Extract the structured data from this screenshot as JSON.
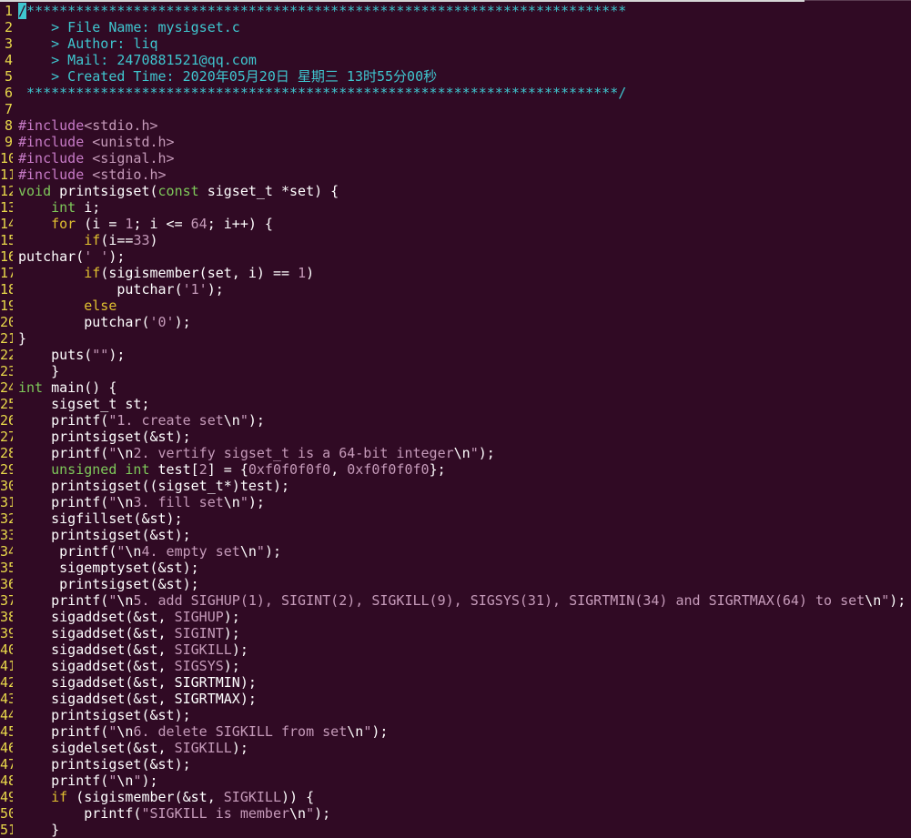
{
  "colors": {
    "background": "#300a24",
    "line_number": "#e8d84a",
    "comment": "#3fc6cf",
    "preprocessor": "#c77bc7",
    "type": "#7ec85a",
    "keyword": "#e0c030",
    "string": "#c59ab9",
    "text": "#ffffff"
  },
  "lines": [
    {
      "n": "1",
      "tokens": [
        {
          "t": "/",
          "c": "cursor"
        },
        {
          "t": "*************************************************************************",
          "c": "comment"
        }
      ]
    },
    {
      "n": "2",
      "tokens": [
        {
          "t": "    > File Name: mysigset.c",
          "c": "comment"
        }
      ]
    },
    {
      "n": "3",
      "tokens": [
        {
          "t": "    > Author: liq",
          "c": "comment"
        }
      ]
    },
    {
      "n": "4",
      "tokens": [
        {
          "t": "    > Mail: 2470881521@qq.com",
          "c": "comment"
        }
      ]
    },
    {
      "n": "5",
      "tokens": [
        {
          "t": "    > Created Time: 2020年05月20日 星期三 13时55分00秒",
          "c": "comment"
        }
      ]
    },
    {
      "n": "6",
      "tokens": [
        {
          "t": " ************************************************************************/",
          "c": "comment"
        }
      ]
    },
    {
      "n": "7",
      "tokens": []
    },
    {
      "n": "8",
      "tokens": [
        {
          "t": "#include",
          "c": "pp"
        },
        {
          "t": "<stdio.h>",
          "c": "str"
        }
      ]
    },
    {
      "n": "9",
      "tokens": [
        {
          "t": "#include ",
          "c": "pp"
        },
        {
          "t": "<unistd.h>",
          "c": "str"
        }
      ]
    },
    {
      "n": "10",
      "tokens": [
        {
          "t": "#include ",
          "c": "pp"
        },
        {
          "t": "<signal.h>",
          "c": "str"
        }
      ]
    },
    {
      "n": "11",
      "tokens": [
        {
          "t": "#include ",
          "c": "pp"
        },
        {
          "t": "<stdio.h>",
          "c": "str"
        }
      ]
    },
    {
      "n": "12",
      "tokens": [
        {
          "t": "void",
          "c": "type"
        },
        {
          "t": " printsigset(",
          "c": "plain"
        },
        {
          "t": "const",
          "c": "type"
        },
        {
          "t": " sigset_t *set) {",
          "c": "plain"
        }
      ]
    },
    {
      "n": "13",
      "tokens": [
        {
          "t": "    ",
          "c": "plain"
        },
        {
          "t": "int",
          "c": "type"
        },
        {
          "t": " i;",
          "c": "plain"
        }
      ]
    },
    {
      "n": "14",
      "tokens": [
        {
          "t": "    ",
          "c": "plain"
        },
        {
          "t": "for",
          "c": "kw"
        },
        {
          "t": " (i = ",
          "c": "plain"
        },
        {
          "t": "1",
          "c": "num"
        },
        {
          "t": "; i <= ",
          "c": "plain"
        },
        {
          "t": "64",
          "c": "num"
        },
        {
          "t": "; i++) {",
          "c": "plain"
        }
      ]
    },
    {
      "n": "15",
      "tokens": [
        {
          "t": "        ",
          "c": "plain"
        },
        {
          "t": "if",
          "c": "kw"
        },
        {
          "t": "(i==",
          "c": "plain"
        },
        {
          "t": "33",
          "c": "num"
        },
        {
          "t": ")",
          "c": "plain"
        }
      ]
    },
    {
      "n": "16",
      "tokens": [
        {
          "t": "putchar(",
          "c": "plain"
        },
        {
          "t": "' '",
          "c": "str"
        },
        {
          "t": ");",
          "c": "plain"
        }
      ]
    },
    {
      "n": "17",
      "tokens": [
        {
          "t": "        ",
          "c": "plain"
        },
        {
          "t": "if",
          "c": "kw"
        },
        {
          "t": "(sigismember(set, i) == ",
          "c": "plain"
        },
        {
          "t": "1",
          "c": "num"
        },
        {
          "t": ")",
          "c": "plain"
        }
      ]
    },
    {
      "n": "18",
      "tokens": [
        {
          "t": "            putchar(",
          "c": "plain"
        },
        {
          "t": "'1'",
          "c": "str"
        },
        {
          "t": ");",
          "c": "plain"
        }
      ]
    },
    {
      "n": "19",
      "tokens": [
        {
          "t": "        ",
          "c": "plain"
        },
        {
          "t": "else",
          "c": "kw"
        }
      ]
    },
    {
      "n": "20",
      "tokens": [
        {
          "t": "        putchar(",
          "c": "plain"
        },
        {
          "t": "'0'",
          "c": "str"
        },
        {
          "t": ");",
          "c": "plain"
        }
      ]
    },
    {
      "n": "21",
      "tokens": [
        {
          "t": "}",
          "c": "plain"
        }
      ]
    },
    {
      "n": "22",
      "tokens": [
        {
          "t": "    puts(",
          "c": "plain"
        },
        {
          "t": "\"\"",
          "c": "str"
        },
        {
          "t": ");",
          "c": "plain"
        }
      ]
    },
    {
      "n": "23",
      "tokens": [
        {
          "t": "    }",
          "c": "plain"
        }
      ]
    },
    {
      "n": "24",
      "tokens": [
        {
          "t": "int",
          "c": "type"
        },
        {
          "t": " main() {",
          "c": "plain"
        }
      ]
    },
    {
      "n": "25",
      "tokens": [
        {
          "t": "    sigset_t st;",
          "c": "plain"
        }
      ]
    },
    {
      "n": "26",
      "tokens": [
        {
          "t": "    printf(",
          "c": "plain"
        },
        {
          "t": "\"1. create set",
          "c": "str"
        },
        {
          "t": "\\n",
          "c": "plain"
        },
        {
          "t": "\"",
          "c": "str"
        },
        {
          "t": ");",
          "c": "plain"
        }
      ]
    },
    {
      "n": "27",
      "tokens": [
        {
          "t": "    printsigset(&st);",
          "c": "plain"
        }
      ]
    },
    {
      "n": "28",
      "tokens": [
        {
          "t": "    printf(",
          "c": "plain"
        },
        {
          "t": "\"",
          "c": "str"
        },
        {
          "t": "\\n",
          "c": "plain"
        },
        {
          "t": "2. vertify sigset_t is a 64-bit integer",
          "c": "str"
        },
        {
          "t": "\\n",
          "c": "plain"
        },
        {
          "t": "\"",
          "c": "str"
        },
        {
          "t": ");",
          "c": "plain"
        }
      ]
    },
    {
      "n": "29",
      "tokens": [
        {
          "t": "    ",
          "c": "plain"
        },
        {
          "t": "unsigned",
          "c": "type"
        },
        {
          "t": " ",
          "c": "plain"
        },
        {
          "t": "int",
          "c": "type"
        },
        {
          "t": " test[",
          "c": "plain"
        },
        {
          "t": "2",
          "c": "num"
        },
        {
          "t": "] = {",
          "c": "plain"
        },
        {
          "t": "0xf0f0f0f0",
          "c": "num"
        },
        {
          "t": ", ",
          "c": "plain"
        },
        {
          "t": "0xf0f0f0f0",
          "c": "num"
        },
        {
          "t": "};",
          "c": "plain"
        }
      ]
    },
    {
      "n": "30",
      "tokens": [
        {
          "t": "    printsigset((sigset_t*)test);",
          "c": "plain"
        }
      ]
    },
    {
      "n": "31",
      "tokens": [
        {
          "t": "    printf(",
          "c": "plain"
        },
        {
          "t": "\"",
          "c": "str"
        },
        {
          "t": "\\n",
          "c": "plain"
        },
        {
          "t": "3. fill set",
          "c": "str"
        },
        {
          "t": "\\n",
          "c": "plain"
        },
        {
          "t": "\"",
          "c": "str"
        },
        {
          "t": ");",
          "c": "plain"
        }
      ]
    },
    {
      "n": "32",
      "tokens": [
        {
          "t": "    sigfillset(&st);",
          "c": "plain"
        }
      ]
    },
    {
      "n": "33",
      "tokens": [
        {
          "t": "    printsigset(&st);",
          "c": "plain"
        }
      ]
    },
    {
      "n": "34",
      "tokens": [
        {
          "t": "     printf(",
          "c": "plain"
        },
        {
          "t": "\"",
          "c": "str"
        },
        {
          "t": "\\n",
          "c": "plain"
        },
        {
          "t": "4. empty set",
          "c": "str"
        },
        {
          "t": "\\n",
          "c": "plain"
        },
        {
          "t": "\"",
          "c": "str"
        },
        {
          "t": ");",
          "c": "plain"
        }
      ]
    },
    {
      "n": "35",
      "tokens": [
        {
          "t": "     sigemptyset(&st);",
          "c": "plain"
        }
      ]
    },
    {
      "n": "36",
      "tokens": [
        {
          "t": "     printsigset(&st);",
          "c": "plain"
        }
      ]
    },
    {
      "n": "37",
      "tokens": [
        {
          "t": "    printf(",
          "c": "plain"
        },
        {
          "t": "\"",
          "c": "str"
        },
        {
          "t": "\\n",
          "c": "plain"
        },
        {
          "t": "5. add SIGHUP(1), SIGINT(2), SIGKILL(9), SIGSYS(31), SIGRTMIN(34) and SIGRTMAX(64) to set",
          "c": "str"
        },
        {
          "t": "\\n",
          "c": "plain"
        },
        {
          "t": "\"",
          "c": "str"
        },
        {
          "t": ");",
          "c": "plain"
        }
      ]
    },
    {
      "n": "38",
      "tokens": [
        {
          "t": "    sigaddset(&st, ",
          "c": "plain"
        },
        {
          "t": "SIGHUP",
          "c": "const"
        },
        {
          "t": ");",
          "c": "plain"
        }
      ]
    },
    {
      "n": "39",
      "tokens": [
        {
          "t": "    sigaddset(&st, ",
          "c": "plain"
        },
        {
          "t": "SIGINT",
          "c": "const"
        },
        {
          "t": ");",
          "c": "plain"
        }
      ]
    },
    {
      "n": "40",
      "tokens": [
        {
          "t": "    sigaddset(&st, ",
          "c": "plain"
        },
        {
          "t": "SIGKILL",
          "c": "const"
        },
        {
          "t": ");",
          "c": "plain"
        }
      ]
    },
    {
      "n": "41",
      "tokens": [
        {
          "t": "    sigaddset(&st, ",
          "c": "plain"
        },
        {
          "t": "SIGSYS",
          "c": "const"
        },
        {
          "t": ");",
          "c": "plain"
        }
      ]
    },
    {
      "n": "42",
      "tokens": [
        {
          "t": "    sigaddset(&st, SIGRTMIN);",
          "c": "plain"
        }
      ]
    },
    {
      "n": "43",
      "tokens": [
        {
          "t": "    sigaddset(&st, SIGRTMAX);",
          "c": "plain"
        }
      ]
    },
    {
      "n": "44",
      "tokens": [
        {
          "t": "    printsigset(&st);",
          "c": "plain"
        }
      ]
    },
    {
      "n": "45",
      "tokens": [
        {
          "t": "    printf(",
          "c": "plain"
        },
        {
          "t": "\"",
          "c": "str"
        },
        {
          "t": "\\n",
          "c": "plain"
        },
        {
          "t": "6. delete SIGKILL from set",
          "c": "str"
        },
        {
          "t": "\\n",
          "c": "plain"
        },
        {
          "t": "\"",
          "c": "str"
        },
        {
          "t": ");",
          "c": "plain"
        }
      ]
    },
    {
      "n": "46",
      "tokens": [
        {
          "t": "    sigdelset(&st, ",
          "c": "plain"
        },
        {
          "t": "SIGKILL",
          "c": "const"
        },
        {
          "t": ");",
          "c": "plain"
        }
      ]
    },
    {
      "n": "47",
      "tokens": [
        {
          "t": "    printsigset(&st);",
          "c": "plain"
        }
      ]
    },
    {
      "n": "48",
      "tokens": [
        {
          "t": "    printf(",
          "c": "plain"
        },
        {
          "t": "\"",
          "c": "str"
        },
        {
          "t": "\\n",
          "c": "plain"
        },
        {
          "t": "\"",
          "c": "str"
        },
        {
          "t": ");",
          "c": "plain"
        }
      ]
    },
    {
      "n": "49",
      "tokens": [
        {
          "t": "    ",
          "c": "plain"
        },
        {
          "t": "if",
          "c": "kw"
        },
        {
          "t": " (sigismember(&st, ",
          "c": "plain"
        },
        {
          "t": "SIGKILL",
          "c": "const"
        },
        {
          "t": ")) {",
          "c": "plain"
        }
      ]
    },
    {
      "n": "50",
      "tokens": [
        {
          "t": "        printf(",
          "c": "plain"
        },
        {
          "t": "\"SIGKILL is member",
          "c": "str"
        },
        {
          "t": "\\n",
          "c": "plain"
        },
        {
          "t": "\"",
          "c": "str"
        },
        {
          "t": ");",
          "c": "plain"
        }
      ]
    },
    {
      "n": "51",
      "tokens": [
        {
          "t": "    }",
          "c": "plain"
        }
      ]
    }
  ]
}
